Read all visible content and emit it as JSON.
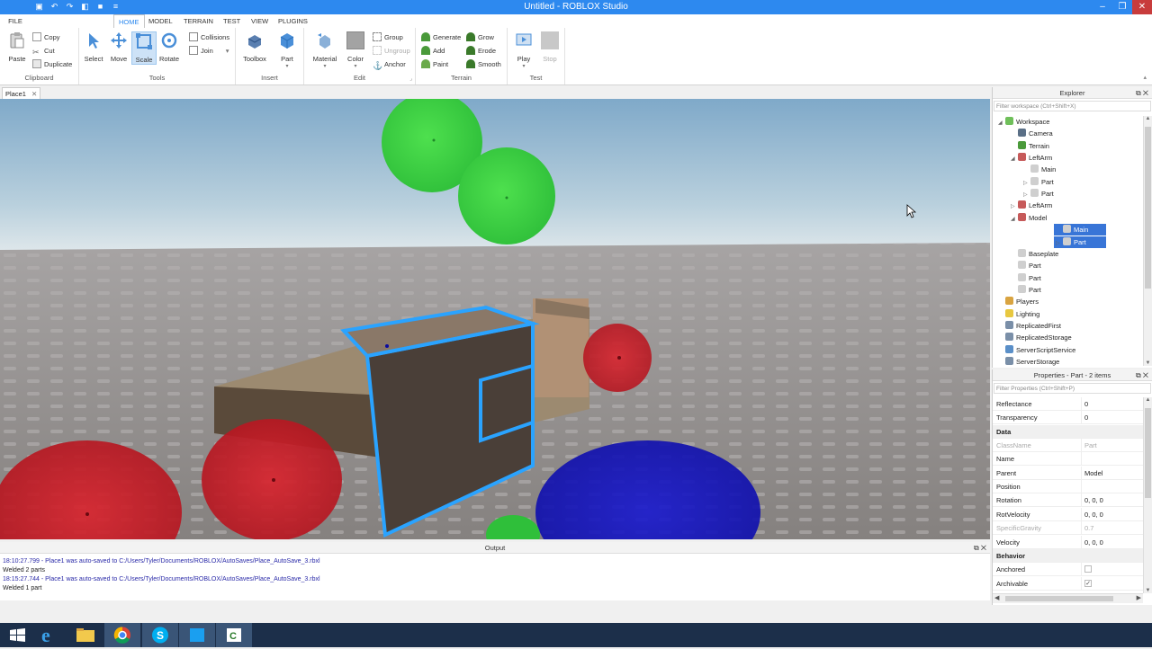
{
  "window": {
    "title": "Untitled - ROBLOX Studio",
    "controls": [
      "–",
      "❐",
      "✕"
    ]
  },
  "ribbon_tabs": [
    "FILE",
    "HOME",
    "MODEL",
    "TERRAIN",
    "TEST",
    "VIEW",
    "PLUGINS"
  ],
  "active_tab": "HOME",
  "clipboard": {
    "paste": "Paste",
    "copy": "Copy",
    "cut": "Cut",
    "duplicate": "Duplicate",
    "label": "Clipboard"
  },
  "tools": {
    "select": "Select",
    "move": "Move",
    "scale": "Scale",
    "rotate": "Rotate",
    "collisions": "Collisions",
    "join": "Join",
    "label": "Tools"
  },
  "insert": {
    "toolbox": "Toolbox",
    "part": "Part",
    "label": "Insert"
  },
  "edit": {
    "material": "Material",
    "color": "Color",
    "group": "Group",
    "ungroup": "Ungroup",
    "anchor": "Anchor",
    "label": "Edit"
  },
  "terrain": {
    "generate": "Generate",
    "add": "Add",
    "paint": "Paint",
    "grow": "Grow",
    "erode": "Erode",
    "smooth": "Smooth",
    "label": "Terrain"
  },
  "test": {
    "play": "Play",
    "stop": "Stop",
    "label": "Test"
  },
  "document_tab": "Place1",
  "output": {
    "title": "Output",
    "lines": [
      {
        "text": "18:10:27.799 - Place1 was auto-saved to C:/Users/Tyler/Documents/ROBLOX/AutoSaves/Place_AutoSave_3.rbxl",
        "link": true
      },
      {
        "text": "Welded 2 parts",
        "link": false
      },
      {
        "text": "18:15:27.744 - Place1 was auto-saved to C:/Users/Tyler/Documents/ROBLOX/AutoSaves/Place_AutoSave_3.rbxl",
        "link": true
      },
      {
        "text": "Welded 1 part",
        "link": false
      }
    ]
  },
  "explorer": {
    "title": "Explorer",
    "filter_placeholder": "Filter workspace (Ctrl+Shift+X)",
    "items": [
      {
        "label": "Workspace",
        "twisty": "◢",
        "icon": "#6fbf5a"
      },
      {
        "label": "Camera",
        "twisty": "",
        "icon": "#5a6f86"
      },
      {
        "label": "Terrain",
        "twisty": "",
        "icon": "#4a9a3a"
      },
      {
        "label": "LeftArm",
        "twisty": "◢",
        "icon": "#c65a5a"
      },
      {
        "label": "Main",
        "twisty": "",
        "icon": "#cfcfcf"
      },
      {
        "label": "Part",
        "twisty": "▷",
        "icon": "#cfcfcf"
      },
      {
        "label": "Part",
        "twisty": "▷",
        "icon": "#cfcfcf"
      },
      {
        "label": "LeftArm",
        "twisty": "▷",
        "icon": "#c65a5a"
      },
      {
        "label": "Model",
        "twisty": "◢",
        "icon": "#c65a5a"
      },
      {
        "label": "Main",
        "twisty": "",
        "icon": "#cfcfcf",
        "selected": true
      },
      {
        "label": "Part",
        "twisty": "▷",
        "icon": "#cfcfcf",
        "selected": true
      },
      {
        "label": "Baseplate",
        "twisty": "",
        "icon": "#cfcfcf"
      },
      {
        "label": "Part",
        "twisty": "",
        "icon": "#cfcfcf"
      },
      {
        "label": "Part",
        "twisty": "",
        "icon": "#cfcfcf"
      },
      {
        "label": "Part",
        "twisty": "",
        "icon": "#cfcfcf"
      },
      {
        "label": "Players",
        "twisty": "",
        "icon": "#d9a441"
      },
      {
        "label": "Lighting",
        "twisty": "",
        "icon": "#e8c840"
      },
      {
        "label": "ReplicatedFirst",
        "twisty": "",
        "icon": "#7a8fa8"
      },
      {
        "label": "ReplicatedStorage",
        "twisty": "",
        "icon": "#7a8fa8"
      },
      {
        "label": "ServerScriptService",
        "twisty": "",
        "icon": "#5a8fc8"
      },
      {
        "label": "ServerStorage",
        "twisty": "",
        "icon": "#7a8fa8"
      }
    ]
  },
  "properties": {
    "title": "Properties - Part - 2 items",
    "filter_placeholder": "Filter Properties (Ctrl+Shift+P)",
    "rows": [
      {
        "name": "Reflectance",
        "value": "0",
        "type": "prop"
      },
      {
        "name": "Transparency",
        "value": "0",
        "type": "prop"
      },
      {
        "name": "Data",
        "value": "",
        "type": "category"
      },
      {
        "name": "ClassName",
        "value": "Part",
        "type": "dim"
      },
      {
        "name": "Name",
        "value": "",
        "type": "prop"
      },
      {
        "name": "Parent",
        "value": "Model",
        "type": "prop"
      },
      {
        "name": "Position",
        "value": "",
        "type": "prop"
      },
      {
        "name": "Rotation",
        "value": "0, 0, 0",
        "type": "prop"
      },
      {
        "name": "RotVelocity",
        "value": "0, 0, 0",
        "type": "prop"
      },
      {
        "name": "SpecificGravity",
        "value": "0.7",
        "type": "dim"
      },
      {
        "name": "Velocity",
        "value": "0, 0, 0",
        "type": "prop"
      },
      {
        "name": "Behavior",
        "value": "",
        "type": "category"
      },
      {
        "name": "Anchored",
        "value": "",
        "type": "check",
        "checked": false
      },
      {
        "name": "Archivable",
        "value": "",
        "type": "check",
        "checked": true
      }
    ]
  },
  "taskbar": {
    "icons": [
      "windows-start-icon",
      "internet-explorer-icon",
      "file-explorer-icon",
      "chrome-icon",
      "skype-icon",
      "roblox-studio-icon",
      "camtasia-icon"
    ]
  }
}
